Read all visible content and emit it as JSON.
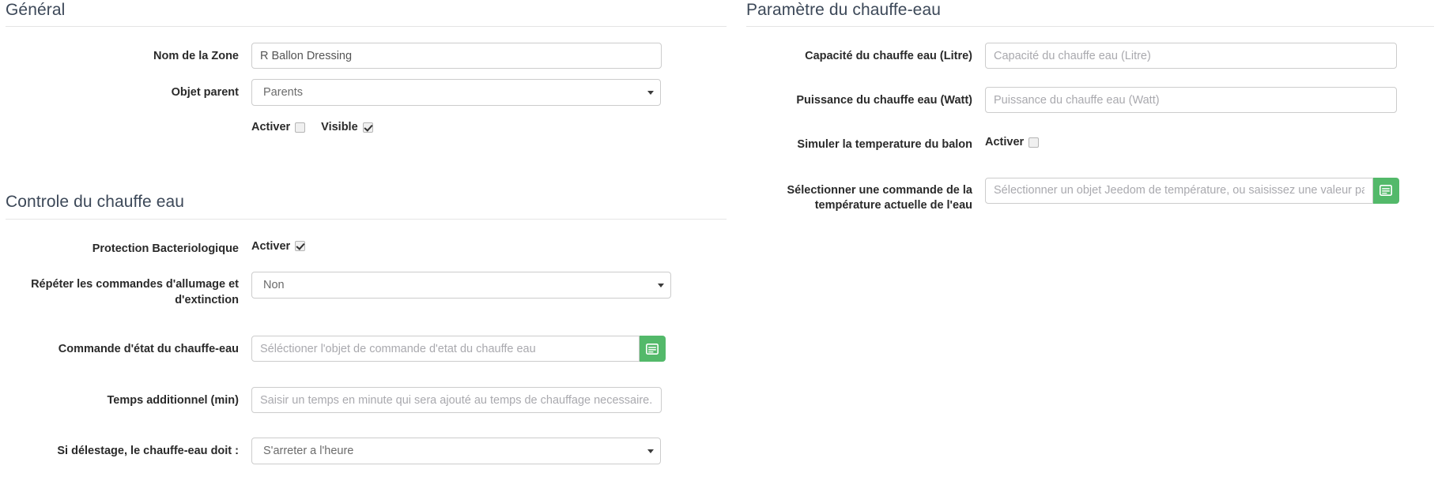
{
  "sections": {
    "general": {
      "title": "Général",
      "name_label": "Nom de la Zone",
      "name_value": "R Ballon Dressing",
      "parent_label": "Objet parent",
      "parent_value": "Parents",
      "parent_options": [
        "Parents"
      ],
      "activer_label": "Activer",
      "activer_checked": false,
      "visible_label": "Visible",
      "visible_checked": true
    },
    "controle": {
      "title": "Controle du chauffe eau",
      "protection_label": "Protection Bacteriologique",
      "protection_activer_label": "Activer",
      "protection_checked": true,
      "repeter_label": "Répéter les commandes d'allumage et d'extinction",
      "repeter_value": "Non",
      "repeter_options": [
        "Non"
      ],
      "commande_etat_label": "Commande d'état du chauffe-eau",
      "commande_etat_placeholder": "Séléctioner l'objet de commande d'etat du chauffe eau",
      "commande_etat_value": "",
      "temps_label": "Temps additionnel (min)",
      "temps_placeholder": "Saisir un temps en minute qui sera ajouté au temps de chauffage necessaire. Ceci pour garantir une eau chaude à l'heure demandée",
      "temps_value": "",
      "delestage_label": "Si délestage, le chauffe-eau doit :",
      "delestage_value": "S'arreter a l'heure",
      "delestage_options": [
        "S'arreter a l'heure"
      ]
    },
    "parametre": {
      "title": "Paramètre du chauffe-eau",
      "capacite_label": "Capacité du chauffe eau (Litre)",
      "capacite_placeholder": "Capacité du chauffe eau (Litre)",
      "capacite_value": "",
      "puissance_label": "Puissance du chauffe eau (Watt)",
      "puissance_placeholder": "Puissance du chauffe eau (Watt)",
      "puissance_value": "",
      "simuler_label": "Simuler la temperature du balon",
      "simuler_activer_label": "Activer",
      "simuler_checked": false,
      "temperature_label": "Sélectionner une commande de la température actuelle de l'eau",
      "temperature_placeholder": "Sélectionner un objet Jeedom de température, ou saisissez une valeur par defaut",
      "temperature_value": ""
    }
  },
  "icons": {
    "select_object_button": "window-list-icon"
  },
  "colors": {
    "accent_green": "#53b96a",
    "heading": "#3c4858",
    "border": "#cccccc",
    "placeholder": "#a9a9ae"
  }
}
